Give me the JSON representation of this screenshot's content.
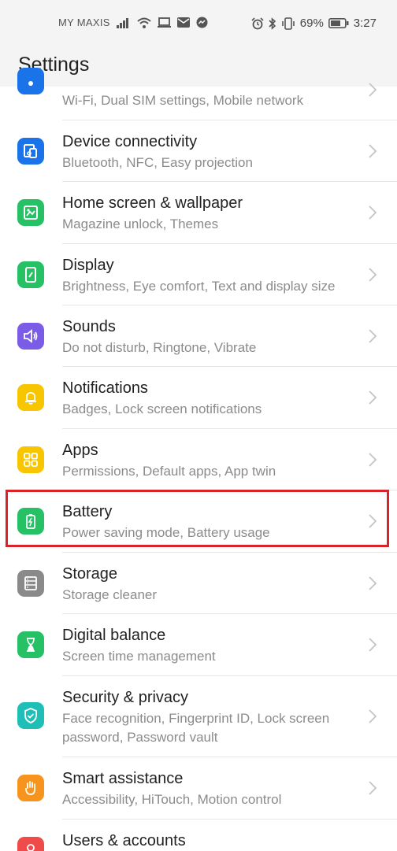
{
  "status_bar": {
    "carrier": "MY MAXIS",
    "battery_percent": "69%",
    "time": "3:27"
  },
  "header": {
    "title": "Settings"
  },
  "colors": {
    "blue": "#1a73e8",
    "green": "#26c165",
    "purple": "#7b5ce6",
    "yellow": "#f7c600",
    "gray": "#8a8a8a",
    "teal": "#1fbfb8",
    "orange": "#f7941d",
    "red": "#ef4b4b",
    "highlight": "#d8232a"
  },
  "items": [
    {
      "title": "",
      "subtitle": "Wi-Fi, Dual SIM settings, Mobile network",
      "icon": "network-icon"
    },
    {
      "title": "Device connectivity",
      "subtitle": "Bluetooth, NFC, Easy projection",
      "icon": "device-connectivity-icon"
    },
    {
      "title": "Home screen & wallpaper",
      "subtitle": "Magazine unlock, Themes",
      "icon": "wallpaper-icon"
    },
    {
      "title": "Display",
      "subtitle": "Brightness, Eye comfort, Text and display size",
      "icon": "display-icon"
    },
    {
      "title": "Sounds",
      "subtitle": "Do not disturb, Ringtone, Vibrate",
      "icon": "speaker-icon"
    },
    {
      "title": "Notifications",
      "subtitle": "Badges, Lock screen notifications",
      "icon": "bell-icon"
    },
    {
      "title": "Apps",
      "subtitle": "Permissions, Default apps, App twin",
      "icon": "apps-grid-icon"
    },
    {
      "title": "Battery",
      "subtitle": "Power saving mode, Battery usage",
      "icon": "battery-icon"
    },
    {
      "title": "Storage",
      "subtitle": "Storage cleaner",
      "icon": "storage-icon"
    },
    {
      "title": "Digital balance",
      "subtitle": "Screen time management",
      "icon": "hourglass-icon"
    },
    {
      "title": "Security & privacy",
      "subtitle": "Face recognition, Fingerprint ID, Lock screen password, Password vault",
      "icon": "shield-icon"
    },
    {
      "title": "Smart assistance",
      "subtitle": "Accessibility, HiTouch, Motion control",
      "icon": "hand-icon"
    },
    {
      "title": "Users & accounts",
      "subtitle": "",
      "icon": "user-icon"
    }
  ]
}
